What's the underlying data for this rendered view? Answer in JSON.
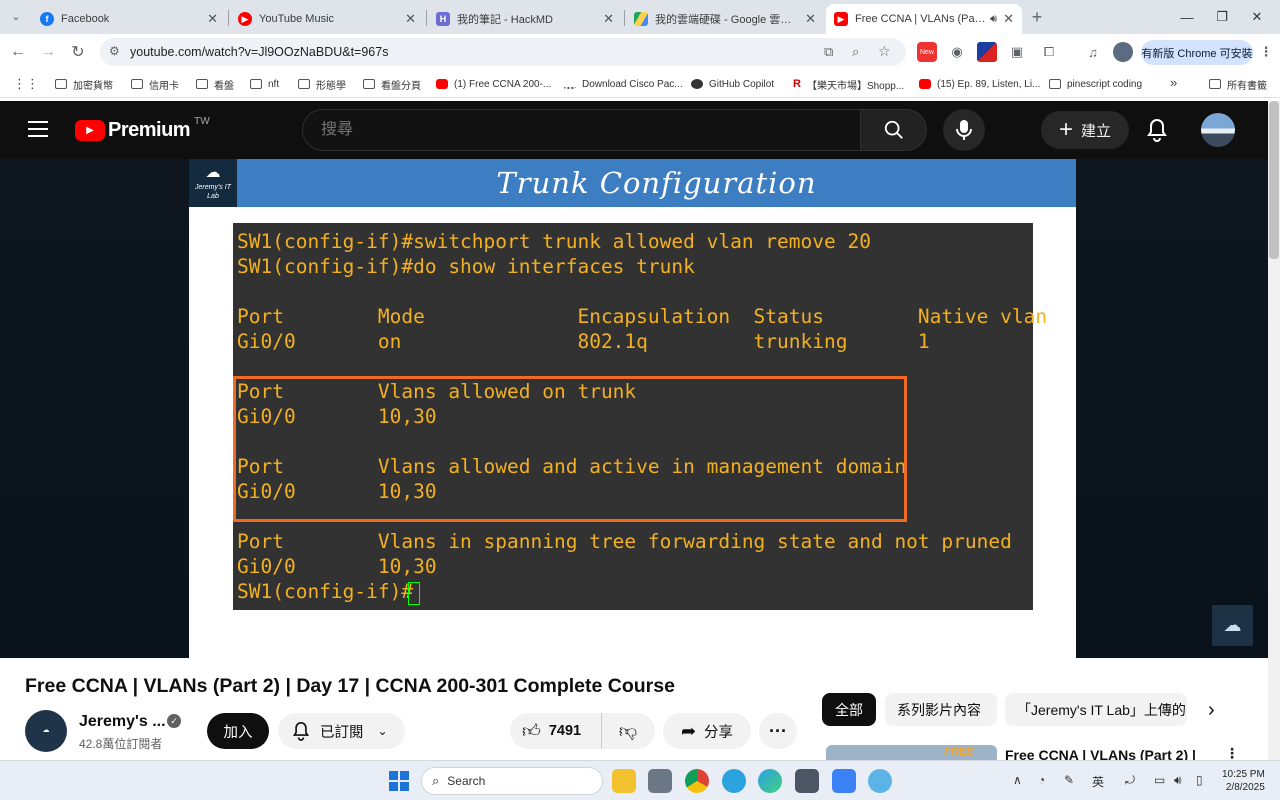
{
  "browser": {
    "tabs": [
      {
        "title": "Facebook",
        "icon": "facebook-icon",
        "color": "#1877f2"
      },
      {
        "title": "YouTube Music",
        "icon": "youtube-music-icon",
        "color": "#ff0000"
      },
      {
        "title": "我的筆記 - HackMD",
        "icon": "hackmd-icon",
        "color": "#6c6cd3"
      },
      {
        "title": "我的雲端硬碟 - Google 雲端硬碟",
        "icon": "google-drive-icon",
        "color": "#1fa463"
      },
      {
        "title": "Free CCNA | VLANs (Part 2)",
        "icon": "youtube-icon",
        "color": "#ff0000"
      }
    ],
    "url": "youtube.com/watch?v=Jl9OOzNaBDU&t=967s",
    "update_label": "有新版 Chrome 可安裝",
    "new_badge": "New"
  },
  "bookmarks": [
    {
      "label": "加密貨幣",
      "icon": "folder-icon"
    },
    {
      "label": "信用卡",
      "icon": "folder-icon"
    },
    {
      "label": "看盤",
      "icon": "folder-icon"
    },
    {
      "label": "nft",
      "icon": "folder-icon"
    },
    {
      "label": "形態學",
      "icon": "folder-icon"
    },
    {
      "label": "看盤分頁",
      "icon": "folder-icon"
    },
    {
      "label": "(1) Free CCNA 200-...",
      "icon": "youtube-icon"
    },
    {
      "label": "Download Cisco Pac...",
      "icon": "cisco-icon"
    },
    {
      "label": "GitHub Copilot",
      "icon": "github-icon"
    },
    {
      "label": "【樂天市場】Shopp...",
      "icon": "rakuten-icon"
    },
    {
      "label": "(15) Ep. 89, Listen, Li...",
      "icon": "youtube-icon"
    },
    {
      "label": "pinescript coding",
      "icon": "folder-icon"
    }
  ],
  "bookmarks_all": "所有書籤",
  "youtube": {
    "brand": "Premium",
    "region": "TW",
    "search_placeholder": "搜尋",
    "create_label": "建立"
  },
  "slide": {
    "logo_text": "Jeremy's IT Lab",
    "title": "Trunk Configuration",
    "terminal_lines": [
      "SW1(config-if)#switchport trunk allowed vlan remove 20",
      "SW1(config-if)#do show interfaces trunk",
      "",
      "Port        Mode             Encapsulation  Status        Native vlan",
      "Gi0/0       on               802.1q         trunking      1",
      "",
      "Port        Vlans allowed on trunk",
      "Gi0/0       10,30",
      "",
      "Port        Vlans allowed and active in management domain",
      "Gi0/0       10,30",
      "",
      "Port        Vlans in spanning tree forwarding state and not pruned",
      "Gi0/0       10,30",
      "SW1(config-if)#"
    ]
  },
  "video": {
    "title": "Free CCNA | VLANs (Part 2) | Day 17 | CCNA 200-301 Complete Course",
    "channel": "Jeremy's ...",
    "subscribers": "42.8萬位訂閱者",
    "join": "加入",
    "subscribed": "已訂閱",
    "likes": "7491",
    "share": "分享"
  },
  "sidebar": {
    "chips": [
      "全部",
      "系列影片內容",
      "「Jeremy's IT Lab」上傳的"
    ],
    "next_title": "Free CCNA | VLANs (Part 2) |",
    "thumb_badge": "FREE"
  },
  "taskbar": {
    "search_label": "Search",
    "ime": "英",
    "time": "10:25 PM",
    "date": "2/8/2025"
  }
}
